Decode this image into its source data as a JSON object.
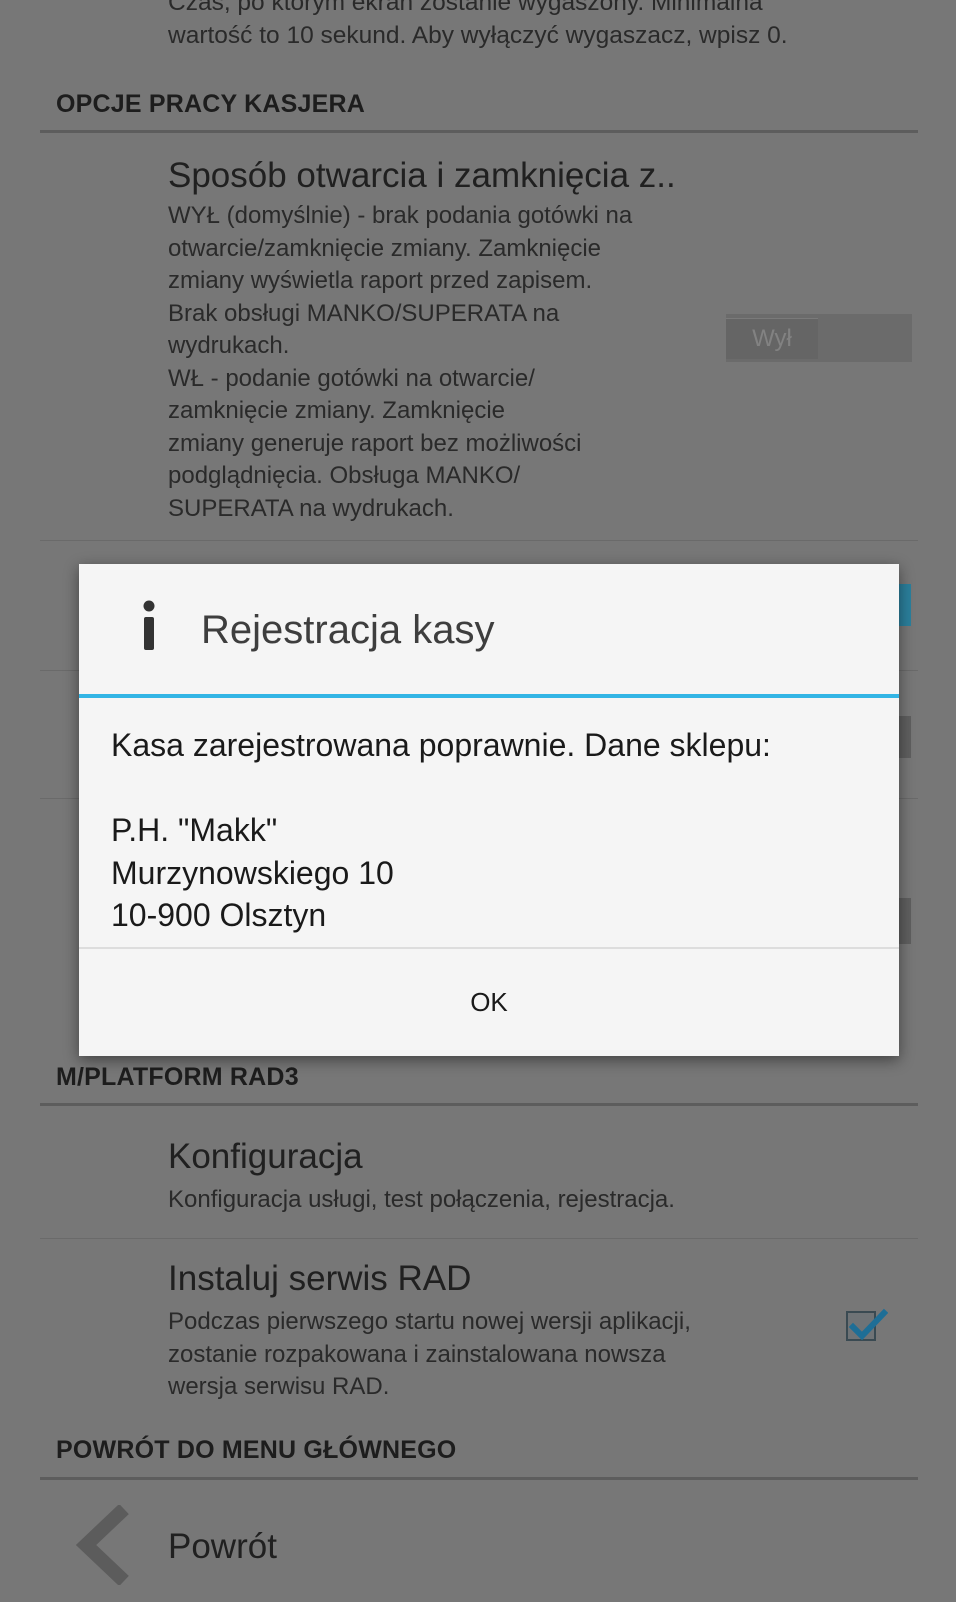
{
  "top_fragment": {
    "line1": "Czas, po którym ekran zostanie wygaszony. Minimalna",
    "line2": "wartość to 10 sekund. Aby wyłączyć wygaszacz, wpisz 0."
  },
  "section_cashier": {
    "header": "OPCJE PRACY KASJERA",
    "item_shift": {
      "title": "Sposób otwarcia i zamknięcia z..",
      "summary_lines": [
        "WYŁ (domyślnie) - brak podania gotówki na",
        "otwarcie/zamknięcie zmiany. Zamknięcie",
        "zmiany wyświetla raport przed zapisem.",
        "Brak obsługi MANKO/SUPERATA na",
        "wydrukach.",
        "WŁ - podanie gotówki na otwarcie/",
        "zamknięcie zmiany. Zamknięcie",
        "zmiany generuje raport bez możliwości",
        "podglądnięcia. Obsługa MANKO/",
        "SUPERATA na wydrukach."
      ],
      "toggle_label": "Wył"
    }
  },
  "section_rad": {
    "header": "M/PLATFORM RAD3",
    "item_config": {
      "title": "Konfiguracja",
      "summary": "Konfiguracja usługi, test połączenia, rejestracja."
    },
    "item_install": {
      "title": "Instaluj serwis RAD",
      "summary_lines": [
        "Podczas pierwszego startu nowej wersji aplikacji,",
        "zostanie rozpakowana i zainstalowana nowsza",
        "wersja serwisu RAD."
      ],
      "checked": true
    }
  },
  "section_back": {
    "header": "POWRÓT DO MENU GŁÓWNEGO",
    "item_back": {
      "title": "Powrót"
    }
  },
  "dialog": {
    "title": "Rejestracja kasy",
    "message": "Kasa zarejestrowana poprawnie. Dane sklepu:\n\nP.H. \"Makk\"\nMurzynowskiego 10\n10-900 Olsztyn",
    "ok_label": "OK"
  },
  "colors": {
    "dialog_accent": "#33b5e5",
    "dim_overlay": "#777777",
    "checkbox_tick": "#1e7fb0"
  }
}
